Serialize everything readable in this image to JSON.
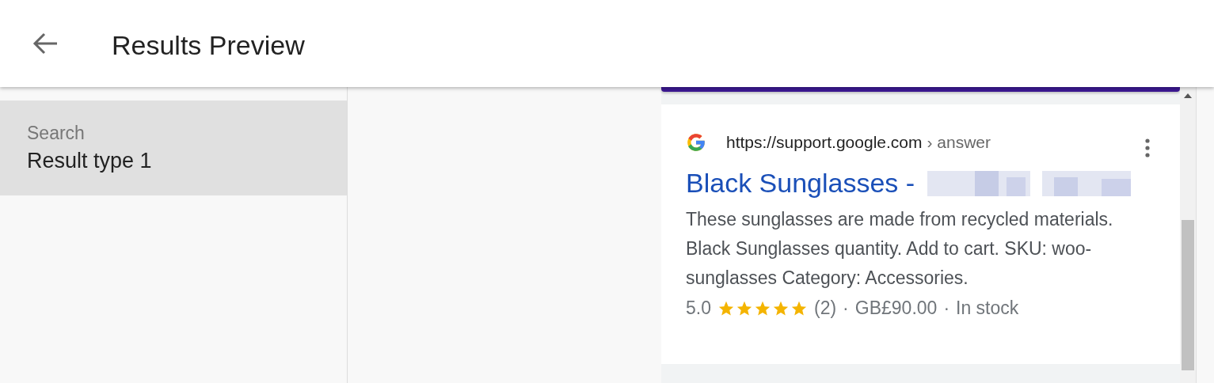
{
  "header": {
    "title": "Results Preview"
  },
  "sidebar": {
    "items": [
      {
        "label": "Search",
        "value": "Result type 1",
        "selected": true
      }
    ]
  },
  "result": {
    "url": "https://support.google.com",
    "breadcrumb": "› answer",
    "title": "Black Sunglasses -",
    "title_redacted": true,
    "snippet": "These sunglasses are made from recycled materials. Black Sunglasses quantity. Add to cart. SKU: woo-sunglasses Category: Accessories.",
    "rating": "5.0",
    "stars": 5,
    "reviews": "(2)",
    "separator_1": "·",
    "price": "GB£90.00",
    "separator_2": "·",
    "availability": "In stock"
  }
}
